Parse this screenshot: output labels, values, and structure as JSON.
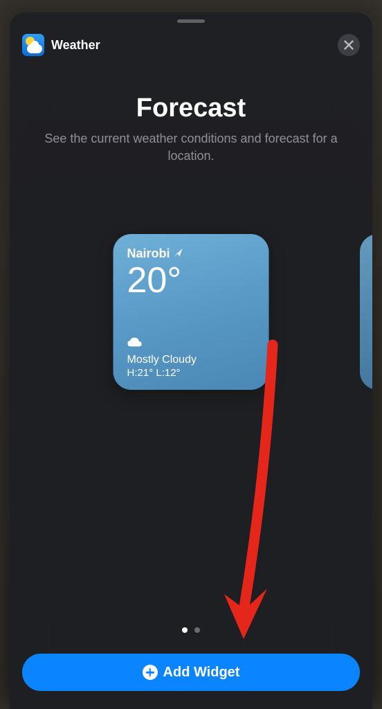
{
  "header": {
    "app_name": "Weather"
  },
  "title": {
    "main": "Forecast",
    "subtitle": "See the current weather conditions and forecast for a location."
  },
  "widget": {
    "location": "Nairobi",
    "temperature": "20°",
    "condition": "Mostly Cloudy",
    "high_low": "H:21° L:12°"
  },
  "pager": {
    "count": 2,
    "active_index": 0
  },
  "actions": {
    "add_widget": "Add Widget"
  },
  "colors": {
    "accent": "#0a84ff",
    "widget_bg": "#5a9bc8"
  }
}
